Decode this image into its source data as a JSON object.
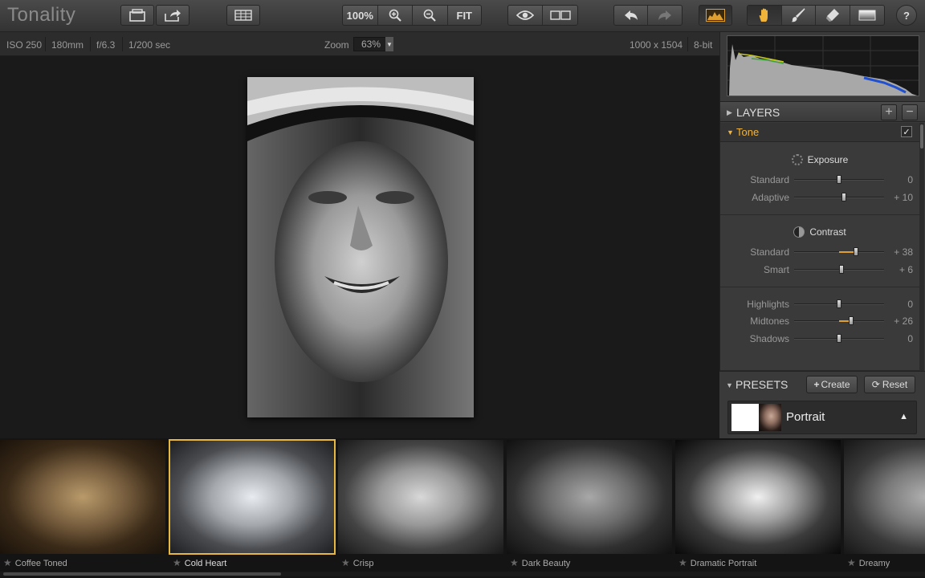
{
  "app": {
    "title": "Tonality"
  },
  "toolbar": {
    "zoom_100": "100%",
    "fit": "FIT",
    "help": "?"
  },
  "info": {
    "iso": "ISO 250",
    "focal": "180mm",
    "aperture": "f/6.3",
    "shutter": "1/200 sec",
    "zoom_label": "Zoom",
    "zoom_value": "63%",
    "dimensions": "1000 x 1504",
    "bitdepth": "8-bit"
  },
  "layers": {
    "label": "LAYERS"
  },
  "tone": {
    "label": "Tone",
    "checked": "✓",
    "exposure": {
      "title": "Exposure",
      "sliders": [
        {
          "name": "Standard",
          "value": "0",
          "level": 0.5
        },
        {
          "name": "Adaptive",
          "value": "+ 10",
          "level": 0.55
        }
      ]
    },
    "contrast": {
      "title": "Contrast",
      "sliders": [
        {
          "name": "Standard",
          "value": "+ 38",
          "level": 0.69
        },
        {
          "name": "Smart",
          "value": "+ 6",
          "level": 0.53
        }
      ]
    },
    "tonal": {
      "sliders": [
        {
          "name": "Highlights",
          "value": "0",
          "level": 0.5
        },
        {
          "name": "Midtones",
          "value": "+ 26",
          "level": 0.63
        },
        {
          "name": "Shadows",
          "value": "0",
          "level": 0.5
        }
      ]
    }
  },
  "presets": {
    "label": "PRESETS",
    "create": "Create",
    "reset": "Reset",
    "selected": "Portrait"
  },
  "filmstrip": [
    {
      "name": "Coffee Toned",
      "selected": false
    },
    {
      "name": "Cold Heart",
      "selected": true
    },
    {
      "name": "Crisp",
      "selected": false
    },
    {
      "name": "Dark Beauty",
      "selected": false
    },
    {
      "name": "Dramatic Portrait",
      "selected": false
    },
    {
      "name": "Dreamy",
      "selected": false
    }
  ],
  "colors": {
    "accent": "#f0b43a",
    "selection": "#e8b93e",
    "background": "#1a1a1a"
  }
}
